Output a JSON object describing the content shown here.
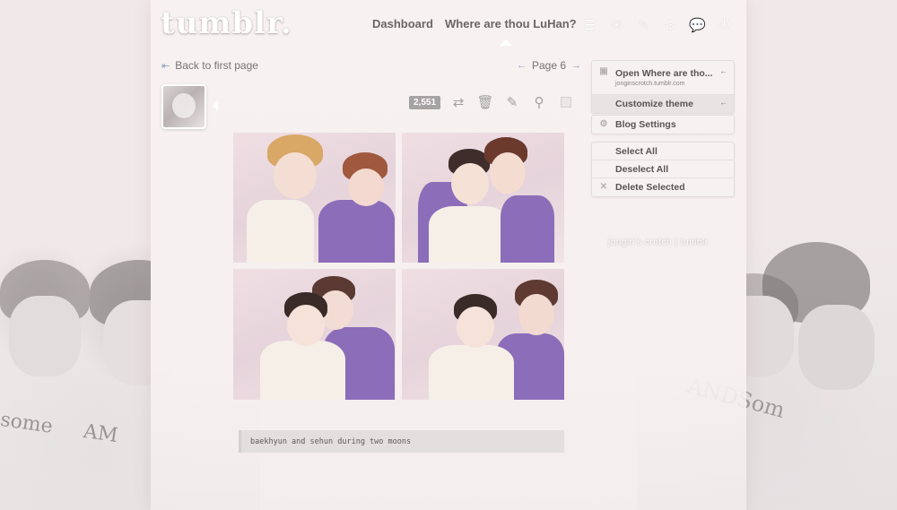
{
  "header": {
    "logo": "tumblr.",
    "nav": {
      "dashboard": "Dashboard",
      "blog": "Where are thou LuHan?"
    },
    "icons": [
      "list-icon",
      "mail-icon",
      "edit-icon",
      "gear-icon",
      "chat-icon",
      "power-icon"
    ]
  },
  "pager": {
    "back": "Back to first page",
    "page": "Page 6"
  },
  "post": {
    "notes": "2,551",
    "caption": "baekhyun and sehun during two moons"
  },
  "sidebar": {
    "blog_title": "Open Where are tho...",
    "blog_url": "jonginscrotch.tumblr.com",
    "customize": "Customize theme",
    "settings": "Blog Settings",
    "select_all": "Select All",
    "deselect_all": "Deselect All",
    "delete_selected": "Delete Selected"
  },
  "credit": "jongin's crotch | tumblr",
  "colors": {
    "background": "#f1e9e9",
    "accent_purple": "#8c6db9",
    "link_arrow": "#8aa0c0"
  }
}
